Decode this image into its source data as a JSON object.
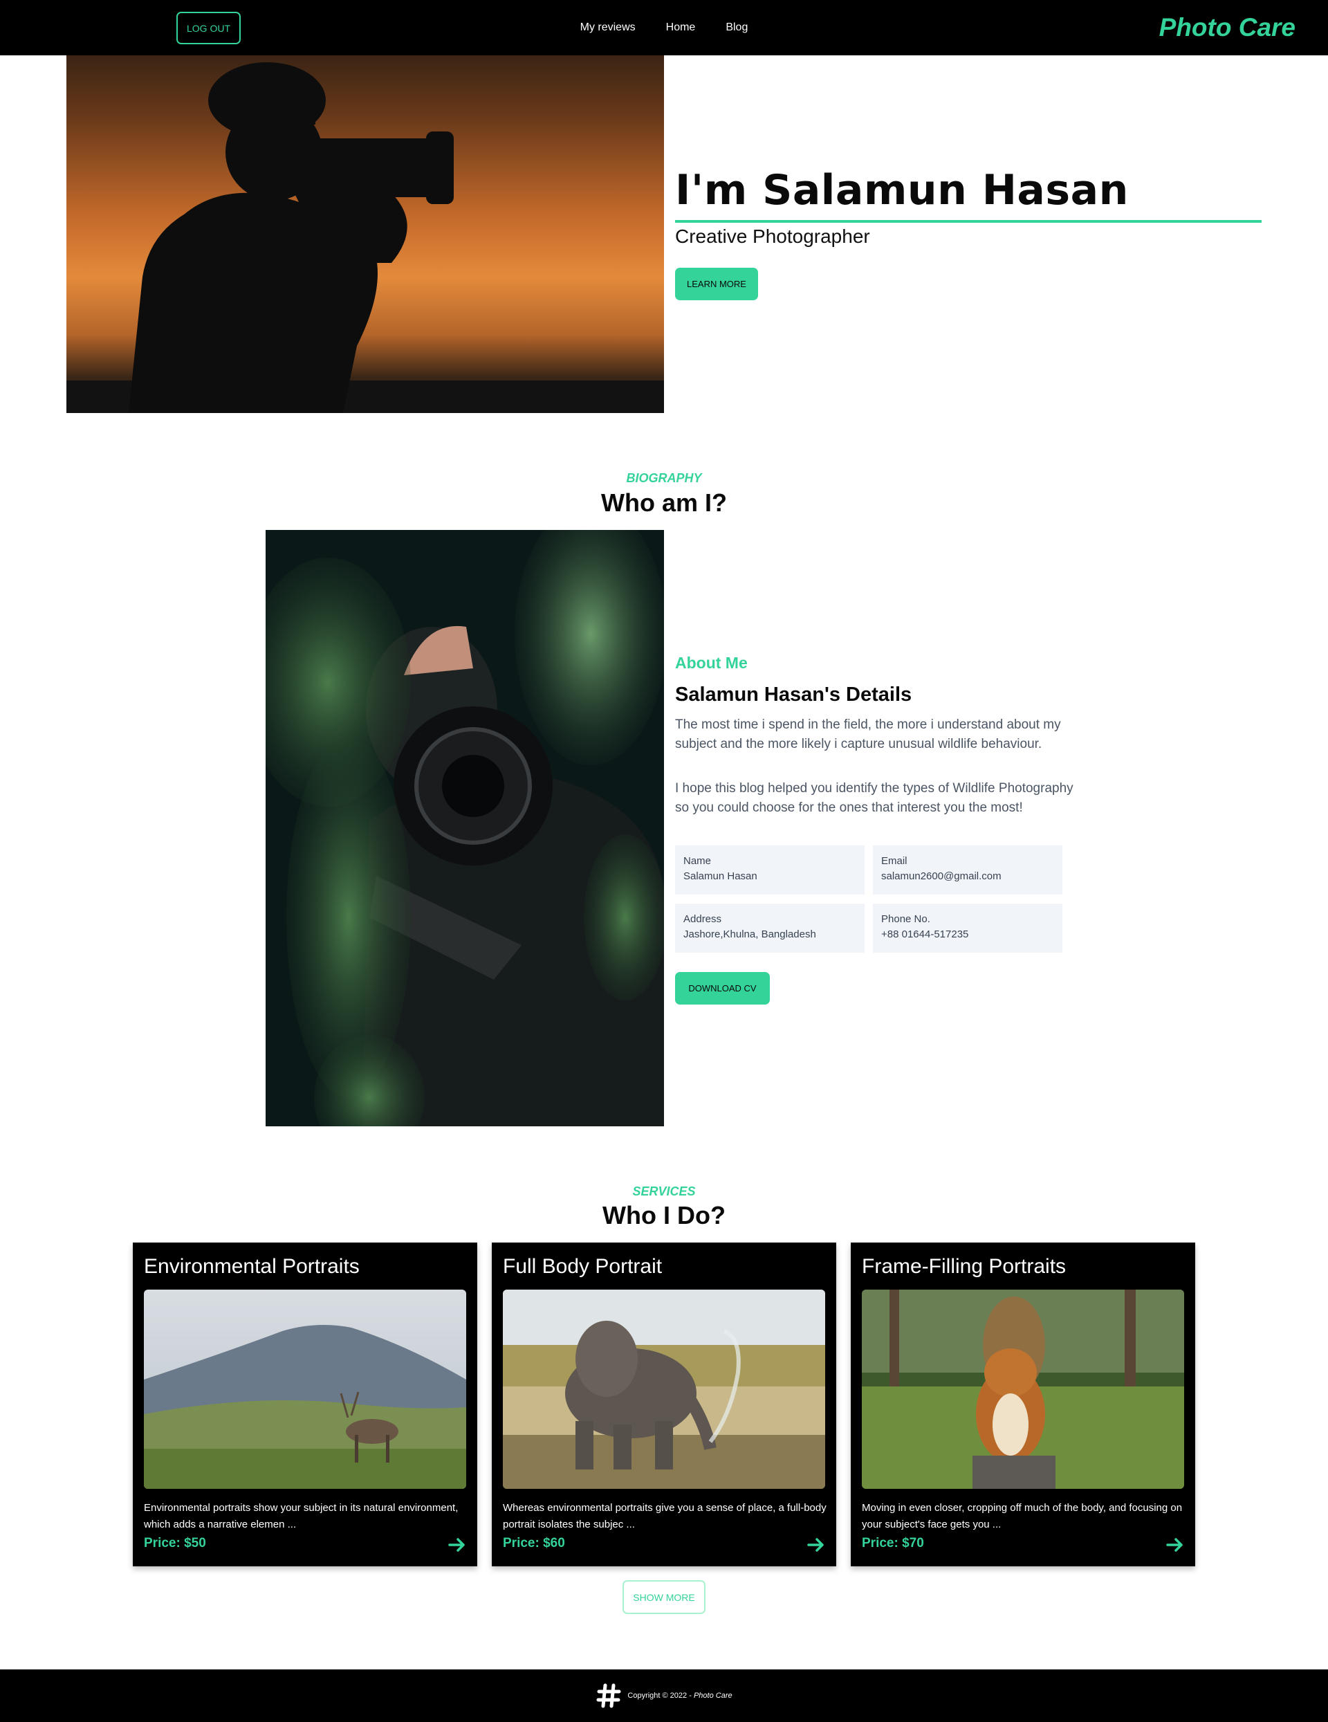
{
  "nav": {
    "logout_label": "LOG OUT",
    "links": [
      "My reviews",
      "Home",
      "Blog"
    ],
    "brand": "Photo Care"
  },
  "hero": {
    "title": "I'm Salamun Hasan",
    "subtitle": "Creative Photographer",
    "cta_label": "LEARN MORE"
  },
  "biography": {
    "eyebrow": "BIOGRAPHY",
    "title": "Who am I?",
    "about_label": "About Me",
    "details_title": "Salamun Hasan's Details",
    "paragraphs": [
      "The most time i spend in the field, the more i understand about my subject and the more likely i capture unusual wildlife behaviour.",
      "I hope this blog helped you identify the types of Wildlife Photography so you could choose for the ones that interest you the most!"
    ],
    "info": [
      {
        "label": "Name",
        "value": "Salamun Hasan"
      },
      {
        "label": "Email",
        "value": "salamun2600@gmail.com"
      },
      {
        "label": "Address",
        "value": "Jashore,Khulna, Bangladesh"
      },
      {
        "label": "Phone No.",
        "value": "+88 01644-517235"
      }
    ],
    "cv_label": "DOWNLOAD CV"
  },
  "services": {
    "eyebrow": "SERVICES",
    "title": "Who I Do?",
    "cards": [
      {
        "title": "Environmental Portraits",
        "desc": "Environmental portraits show your subject in its natural environment, which adds a narrative elemen ...",
        "price": "Price: $50"
      },
      {
        "title": "Full Body Portrait",
        "desc": "Whereas environmental portraits give you a sense of place, a full-body portrait isolates the subjec ...",
        "price": "Price: $60"
      },
      {
        "title": "Frame-Filling Portraits",
        "desc": "Moving in even closer, cropping off much of the body, and focusing on your subject's face gets you ...",
        "price": "Price: $70"
      }
    ],
    "show_more_label": "SHOW MORE"
  },
  "footer": {
    "copyright": "Copyright © 2022 -",
    "brand": "Photo Care"
  },
  "colors": {
    "accent": "#34d399",
    "nav_bg": "#000000",
    "card_bg": "#000000",
    "info_bg": "#f1f5f9"
  }
}
